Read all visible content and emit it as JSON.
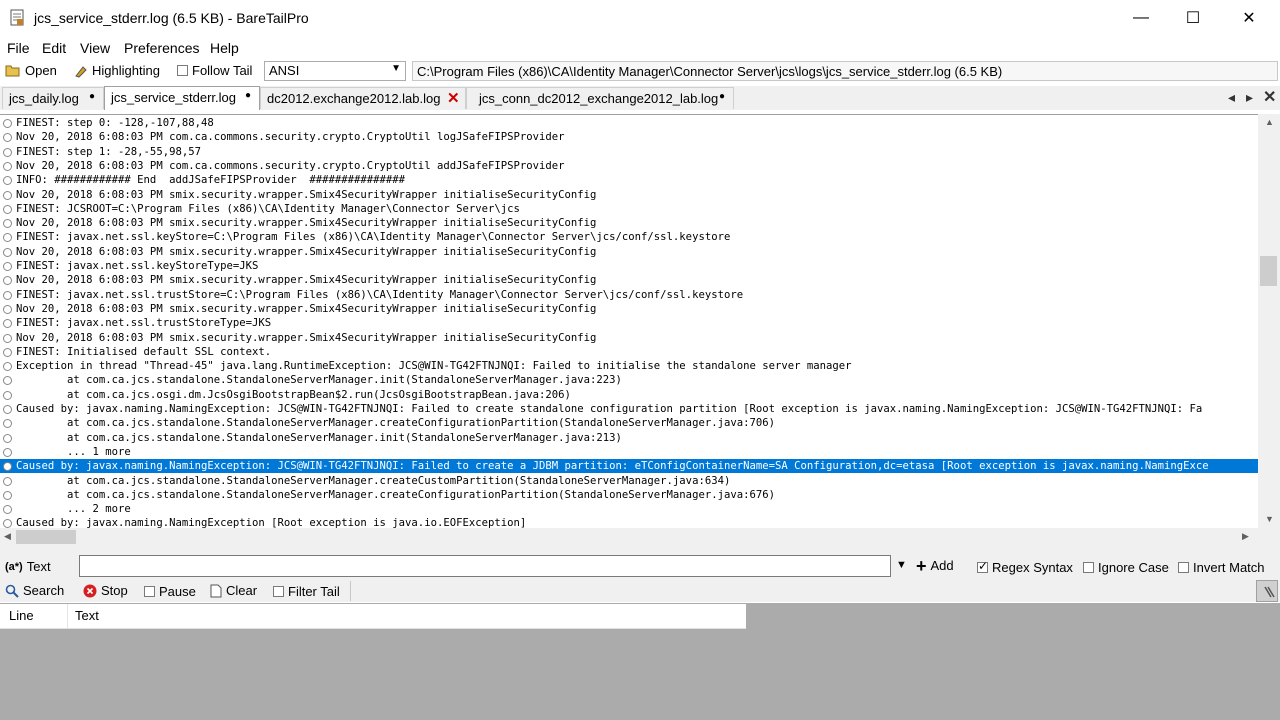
{
  "window": {
    "title": "jcs_service_stderr.log (6.5 KB) - BareTailPro",
    "controls": {
      "minimize": "—",
      "maximize": "☐",
      "close": "✕"
    }
  },
  "menu": [
    "File",
    "Edit",
    "View",
    "Preferences",
    "Help"
  ],
  "toolbar": {
    "open": "Open",
    "highlighting": "Highlighting",
    "follow_tail": "Follow Tail",
    "encoding": "ANSI",
    "path": "C:\\Program Files (x86)\\CA\\Identity Manager\\Connector Server\\jcs\\logs\\jcs_service_stderr.log (6.5 KB)"
  },
  "tabs": [
    {
      "label": "jcs_daily.log",
      "active": false
    },
    {
      "label": "jcs_service_stderr.log",
      "active": true
    },
    {
      "label": "dc2012.exchange2012.lab.log",
      "active": false
    },
    {
      "label": "jcs_conn_dc2012_exchange2012_lab.log",
      "active": false
    }
  ],
  "log_lines": [
    "FINEST: step 0: -128,-107,88,48",
    "Nov 20, 2018 6:08:03 PM com.ca.commons.security.crypto.CryptoUtil logJSafeFIPSProvider",
    "FINEST: step 1: -28,-55,98,57",
    "Nov 20, 2018 6:08:03 PM com.ca.commons.security.crypto.CryptoUtil addJSafeFIPSProvider",
    "INFO: ############ End  addJSafeFIPSProvider  ###############",
    "Nov 20, 2018 6:08:03 PM smix.security.wrapper.Smix4SecurityWrapper initialiseSecurityConfig",
    "FINEST: JCSROOT=C:\\Program Files (x86)\\CA\\Identity Manager\\Connector Server\\jcs",
    "Nov 20, 2018 6:08:03 PM smix.security.wrapper.Smix4SecurityWrapper initialiseSecurityConfig",
    "FINEST: javax.net.ssl.keyStore=C:\\Program Files (x86)\\CA\\Identity Manager\\Connector Server\\jcs/conf/ssl.keystore",
    "Nov 20, 2018 6:08:03 PM smix.security.wrapper.Smix4SecurityWrapper initialiseSecurityConfig",
    "FINEST: javax.net.ssl.keyStoreType=JKS",
    "Nov 20, 2018 6:08:03 PM smix.security.wrapper.Smix4SecurityWrapper initialiseSecurityConfig",
    "FINEST: javax.net.ssl.trustStore=C:\\Program Files (x86)\\CA\\Identity Manager\\Connector Server\\jcs/conf/ssl.keystore",
    "Nov 20, 2018 6:08:03 PM smix.security.wrapper.Smix4SecurityWrapper initialiseSecurityConfig",
    "FINEST: javax.net.ssl.trustStoreType=JKS",
    "Nov 20, 2018 6:08:03 PM smix.security.wrapper.Smix4SecurityWrapper initialiseSecurityConfig",
    "FINEST: Initialised default SSL context.",
    "Exception in thread \"Thread-45\" java.lang.RuntimeException: JCS@WIN-TG42FTNJNQI: Failed to initialise the standalone server manager",
    "        at com.ca.jcs.standalone.StandaloneServerManager.init(StandaloneServerManager.java:223)",
    "        at com.ca.jcs.osgi.dm.JcsOsgiBootstrapBean$2.run(JcsOsgiBootstrapBean.java:206)",
    "Caused by: javax.naming.NamingException: JCS@WIN-TG42FTNJNQI: Failed to create standalone configuration partition [Root exception is javax.naming.NamingException: JCS@WIN-TG42FTNJNQI: Fa",
    "        at com.ca.jcs.standalone.StandaloneServerManager.createConfigurationPartition(StandaloneServerManager.java:706)",
    "        at com.ca.jcs.standalone.StandaloneServerManager.init(StandaloneServerManager.java:213)",
    "        ... 1 more",
    "Caused by: javax.naming.NamingException: JCS@WIN-TG42FTNJNQI: Failed to create a JDBM partition: eTConfigContainerName=SA Configuration,dc=etasa [Root exception is javax.naming.NamingExce",
    "        at com.ca.jcs.standalone.StandaloneServerManager.createCustomPartition(StandaloneServerManager.java:634)",
    "        at com.ca.jcs.standalone.StandaloneServerManager.createConfigurationPartition(StandaloneServerManager.java:676)",
    "        ... 2 more",
    "Caused by: javax.naming.NamingException [Root exception is java.io.EOFException]"
  ],
  "selected_line": 24,
  "search": {
    "mode_label": "Text",
    "mode_prefix": "(a*)",
    "value": "",
    "add": "Add",
    "regex": "Regex Syntax",
    "ignore_case": "Ignore Case",
    "invert_match": "Invert Match",
    "search": "Search",
    "stop": "Stop",
    "pause": "Pause",
    "clear": "Clear",
    "filter_tail": "Filter Tail"
  },
  "results": {
    "col_line": "Line",
    "col_text": "Text"
  },
  "colors": {
    "selection": "#0078d7",
    "stop_red": "#d42020",
    "close_red": "#cc0000"
  }
}
